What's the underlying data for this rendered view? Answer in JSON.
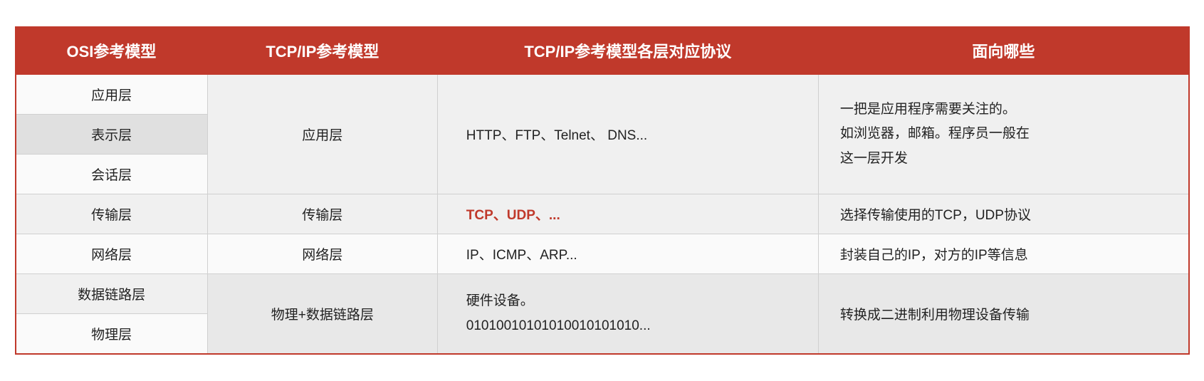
{
  "table": {
    "headers": [
      "OSI参考模型",
      "TCP/IP参考模型",
      "TCP/IP参考模型各层对应协议",
      "面向哪些"
    ],
    "rows": [
      {
        "osi": "应用层",
        "tcp": "应用层",
        "protocols": "HTTP、FTP、Telnet、 DNS...",
        "description": "一把是应用程序需要关注的。\n如浏览器，邮箱。程序员一般在\n这一层开发",
        "osi_rowspan": 3,
        "tcp_rowspan": 3,
        "proto_rowspan": 3,
        "desc_rowspan": 3,
        "highlight": false
      },
      {
        "osi": "表示层",
        "highlight": true
      },
      {
        "osi": "会话层",
        "highlight": false
      },
      {
        "osi": "传输层",
        "tcp": "传输层",
        "protocols": "TCP、UDP、...",
        "protocols_red": true,
        "description": "选择传输使用的TCP，UDP协议",
        "highlight": false
      },
      {
        "osi": "网络层",
        "tcp": "网络层",
        "protocols": "IP、ICMP、ARP...",
        "description": "封装自己的IP，对方的IP等信息",
        "highlight": false
      },
      {
        "osi": "数据链路层",
        "tcp": "物理+数据链路层",
        "protocols": "硬件设备。\n01010010101010010101010...",
        "description": "转换成二进制利用物理设备传输",
        "osi_rowspan": 2,
        "tcp_rowspan": 2,
        "proto_rowspan": 2,
        "desc_rowspan": 2,
        "highlight": false
      },
      {
        "osi": "物理层",
        "highlight": false
      }
    ]
  }
}
